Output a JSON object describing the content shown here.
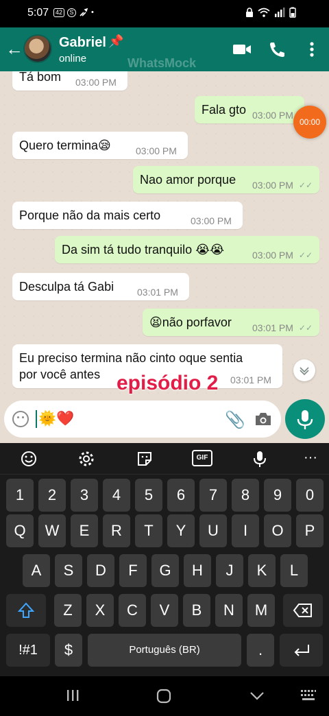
{
  "status_bar": {
    "time": "5:07",
    "notif_badge": "42",
    "notif_s": "S",
    "dot": "•"
  },
  "header": {
    "name": "Gabriel",
    "status": "online",
    "watermark": "WhatsMock",
    "back_icon": "back-arrow-icon",
    "icons": [
      "video-call-icon",
      "phone-icon",
      "more-vert-icon"
    ]
  },
  "messages": [
    {
      "dir": "in",
      "text": "Tá bom",
      "time": "03:00 PM"
    },
    {
      "dir": "out",
      "text": "Fala gto",
      "time": "03:00 PM"
    },
    {
      "dir": "in",
      "text": "Quero termina😪",
      "time": "03:00 PM"
    },
    {
      "dir": "out",
      "text": "Nao amor porque",
      "time": "03:00 PM"
    },
    {
      "dir": "in",
      "text": "Porque não da mais certo",
      "time": "03:00 PM"
    },
    {
      "dir": "out",
      "text": "Da sim tá tudo tranquilo 😭😭",
      "time": "03:00 PM"
    },
    {
      "dir": "in",
      "text": "Desculpa tá Gabi",
      "time": "03:01 PM"
    },
    {
      "dir": "out",
      "text": "😫não porfavor",
      "time": "03:01 PM"
    },
    {
      "dir": "in",
      "text_line1": "Eu preciso termina não cinto oque sentia",
      "text_line2": "por você antes",
      "time": "03:01 PM"
    }
  ],
  "overlay": {
    "timer": "00:00",
    "episode": "episódio 2"
  },
  "input": {
    "text": "🌞❤️"
  },
  "keyboard": {
    "number_row": [
      "1",
      "2",
      "3",
      "4",
      "5",
      "6",
      "7",
      "8",
      "9",
      "0"
    ],
    "row1": [
      "Q",
      "W",
      "E",
      "R",
      "T",
      "Y",
      "U",
      "I",
      "O",
      "P"
    ],
    "row2": [
      "A",
      "S",
      "D",
      "F",
      "G",
      "H",
      "J",
      "K",
      "L"
    ],
    "row3": [
      "Z",
      "X",
      "C",
      "V",
      "B",
      "N",
      "M"
    ],
    "symbols_key": "!#1",
    "currency_key": "$",
    "space_label": "Português (BR)",
    "period_key": ".",
    "gif_label": "GIF",
    "more_label": "···"
  },
  "colors": {
    "header": "#0a7766",
    "outgoing": "#dcf8c6",
    "incoming": "#ffffff",
    "episode": "#e11d48",
    "timer": "#f26b1d"
  }
}
